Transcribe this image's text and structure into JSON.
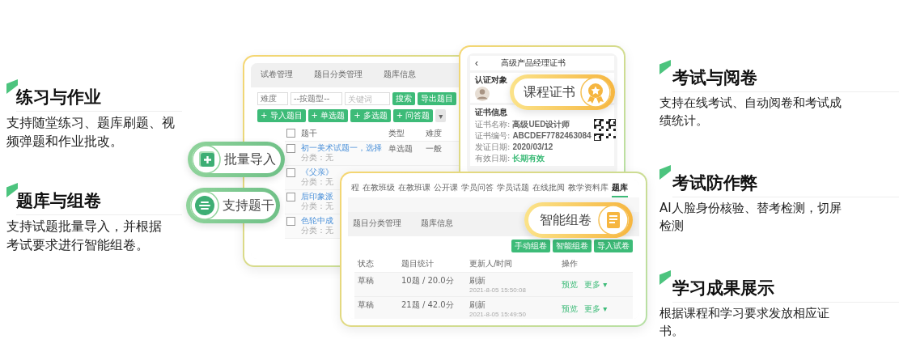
{
  "features_left": [
    {
      "title": "练习与作业",
      "description": [
        "支持随堂练习、题库刷题、视",
        "频弹题和作业批改。"
      ]
    },
    {
      "title": "题库与组卷",
      "description": [
        "支持试题批量导入，并根据",
        "考试要求进行智能组卷。"
      ]
    }
  ],
  "question_bank": {
    "tabs": [
      {
        "label": "试卷管理",
        "selected": false
      },
      {
        "label": "题目分类管理",
        "selected": false
      },
      {
        "label": "题库信息",
        "selected": false
      }
    ],
    "filters": {
      "difficulty": "难度",
      "type": "--按题型--",
      "keyword_placeholder": "关键词"
    },
    "filter_buttons": [
      "搜索",
      "导出题目"
    ],
    "add_buttons": [
      "+ 导入题目",
      "+ 单选题",
      "+ 多选题",
      "+ 问答题",
      "▾"
    ],
    "columns": [
      "题干",
      "类型",
      "难度"
    ],
    "all_checked": false,
    "rows": [
      {
        "stem": "初一美术试题一，选择",
        "type": "单选题",
        "difficulty": "一般",
        "category": "分类：无",
        "checked": false
      },
      {
        "stem": "《父亲》",
        "category": "分类：无",
        "checked": false
      },
      {
        "stem": "后印象派",
        "category": "分类：无",
        "checked": false
      },
      {
        "stem": "色轮中成",
        "category": "分类：无",
        "checked": false
      }
    ]
  },
  "certificate": {
    "back": "‹",
    "title": "高级产品经理证书",
    "subject_heading": "认证对象",
    "info_heading": "证书信息",
    "fields": [
      {
        "label": "证书名称:",
        "value": "高级UED设计师",
        "color": "#666666"
      },
      {
        "label": "证书编号:",
        "value": "ABCDEF7782463084",
        "color": "#666666"
      },
      {
        "label": "发证日期:",
        "value": "2020/03/12",
        "color": "#666666"
      },
      {
        "label": "有效日期:",
        "value": "长期有效",
        "color": "#3dbb78"
      }
    ]
  },
  "paper_bank": {
    "tabs": [
      {
        "label": "程",
        "selected": false
      },
      {
        "label": "在教班级",
        "selected": false
      },
      {
        "label": "在教班课",
        "selected": false
      },
      {
        "label": "公开课",
        "selected": false
      },
      {
        "label": "学员问答",
        "selected": false
      },
      {
        "label": "学员话题",
        "selected": false
      },
      {
        "label": "在线批阅",
        "selected": false
      },
      {
        "label": "教学资料库",
        "selected": false
      },
      {
        "label": "题库",
        "selected": true
      }
    ],
    "subtabs": [
      "题目分类管理",
      "题库信息"
    ],
    "actions": [
      "手动组卷",
      "智能组卷",
      "导入试卷"
    ],
    "columns": [
      "状态",
      "题目统计",
      "更新人/时间",
      "操作"
    ],
    "rows": [
      {
        "status": "草稿",
        "count": "10题 / 20.0分",
        "updater": "刷新",
        "time": "2021-8-05 15:50:08",
        "links": [
          "预览",
          "更多 ▾"
        ]
      },
      {
        "status": "草稿",
        "count": "21题 / 42.0分",
        "updater": "刷新",
        "time": "2021-8-05 15:49:50",
        "links": [
          "预览",
          "更多 ▾"
        ]
      }
    ]
  },
  "badges": [
    {
      "label": "批量导入",
      "kind": "import"
    },
    {
      "label": "支持题干",
      "kind": "stem"
    },
    {
      "label": "课程证书",
      "kind": "certificate"
    },
    {
      "label": "智能组卷",
      "kind": "compose"
    }
  ],
  "features_right": [
    {
      "title": "考试与阅卷",
      "description": [
        "支持在线考试、自动阅卷和考试成",
        "绩统计。"
      ]
    },
    {
      "title": "考试防作弊",
      "description": [
        "AI人脸身份核验、替考检测，切屏",
        "检测"
      ]
    },
    {
      "title": "学习成果展示",
      "description": [
        "根据课程和学习要求发放相应证",
        "书。"
      ]
    }
  ]
}
